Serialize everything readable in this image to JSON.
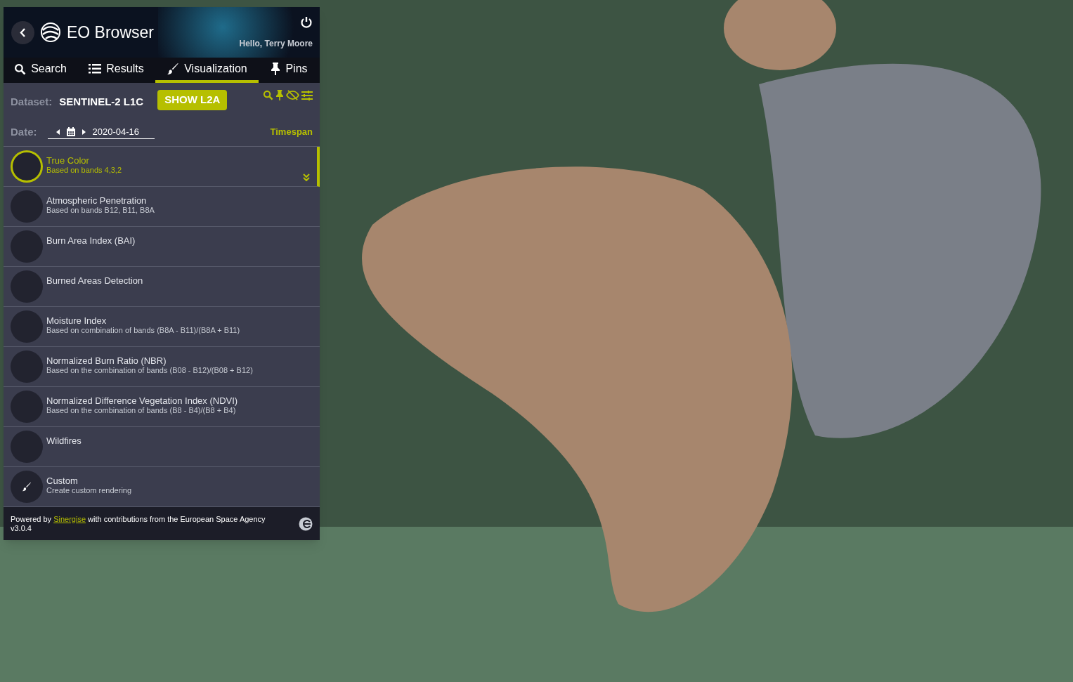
{
  "header": {
    "title": "EO Browser",
    "greeting": "Hello, Terry Moore"
  },
  "tabs": [
    {
      "label": "Search",
      "kind": "search",
      "selected": false
    },
    {
      "label": "Results",
      "kind": "list",
      "selected": false
    },
    {
      "label": "Visualization",
      "kind": "brush",
      "selected": true
    },
    {
      "label": "Pins",
      "kind": "pin",
      "selected": false
    }
  ],
  "dataset": {
    "label": "Dataset:",
    "value": "SENTINEL-2 L1C",
    "button": "SHOW L2A"
  },
  "date": {
    "label": "Date:",
    "value": "2020-04-16",
    "timespan": "Timespan"
  },
  "layers": [
    {
      "kind": "preview",
      "title": "True Color",
      "subtitle": "Based on bands 4,3,2",
      "selected": true
    },
    {
      "kind": "preview",
      "title": "Atmospheric Penetration",
      "subtitle": "Based on bands B12, B11, B8A",
      "selected": false
    },
    {
      "kind": "preview",
      "title": "Burn Area Index (BAI)",
      "selected": false
    },
    {
      "kind": "preview",
      "title": "Burned Areas Detection",
      "selected": false
    },
    {
      "kind": "preview",
      "title": "Moisture Index",
      "subtitle": "Based on combination of bands (B8A - B11)/(B8A + B11)",
      "selected": false
    },
    {
      "kind": "preview",
      "title": "Normalized Burn Ratio (NBR)",
      "subtitle": "Based on the combination of bands (B08 - B12)/(B08 + B12)",
      "selected": false
    },
    {
      "kind": "preview",
      "title": "Normalized Difference Vegetation Index (NDVI)",
      "subtitle": "Based on the combination of bands (B8 - B4)/(B8 + B4)",
      "selected": false
    },
    {
      "kind": "preview",
      "title": "Wildfires",
      "selected": false
    },
    {
      "kind": "custom",
      "title": "Custom",
      "subtitle": "Create custom rendering",
      "selected": false
    }
  ],
  "footer": {
    "prefix": "Powered by",
    "link": "Sinergise",
    "suffix": "with contributions from the European Space Agency",
    "version": "v3.0.4"
  }
}
